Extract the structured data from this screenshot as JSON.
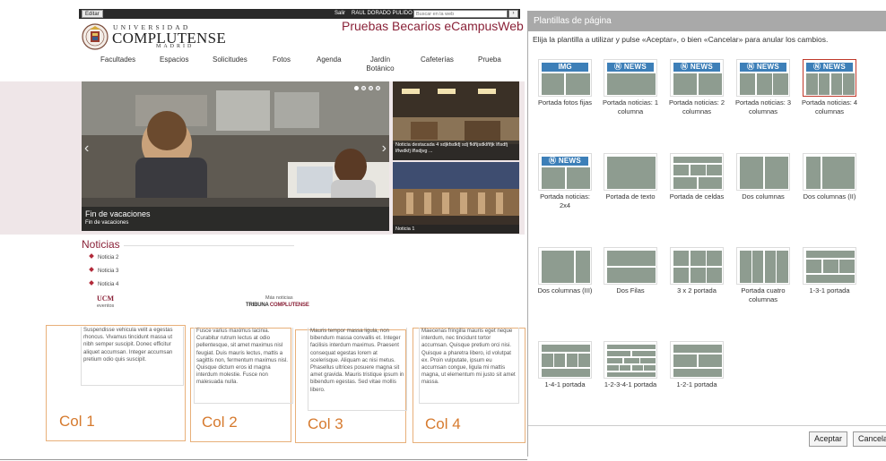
{
  "topbar": {
    "edit_label": "Editar",
    "logout_label": "Salir",
    "user_name": "RAUL DORADO PULIDO",
    "search_placeholder": "Buscar en la web",
    "search_button": "Ir"
  },
  "logo": {
    "line1": "UNIVERSIDAD",
    "line2": "COMPLUTENSE",
    "line3": "MADRID"
  },
  "site_title": "Pruebas Becarios eCampusWeb",
  "nav": [
    "Facultades",
    "Espacios",
    "Solicitudes",
    "Fotos",
    "Agenda",
    "Jardín Botánico",
    "Cafeterías",
    "Prueba"
  ],
  "hero": {
    "title": "Fin de vacaciones",
    "subtitle": "Fin de vacaciones",
    "side1_caption": "Noticia destacada 4 sdjkfsdkfj sdj fklñjsdklñfjk lñsdfj lñwdkfj lñsdjvg ...",
    "side2_caption": "Noticia 1"
  },
  "news": {
    "title": "Noticias",
    "items": [
      "Noticia 2",
      "Noticia 3",
      "Noticia 4"
    ],
    "ucm_label": "UCM",
    "ucm_sub": "eventos",
    "more_label": "Más noticias",
    "tribuna_a": "TRIBUNA",
    "tribuna_b": "COMPLUTENSE"
  },
  "columns": [
    {
      "label": "Col 1",
      "text": "Suspendisse vehicula velit a egestas rhoncus. Vivamus tincidunt massa ut nibh semper suscipit. Donec efficitur aliquet accumsan. Integer accumsan pretium odio quis suscipit."
    },
    {
      "label": "Col 2",
      "text": "Fusce varius maximus lacinia. Curabitur rutrum lectus at odio pellentesque, sit amet maximus nisl feugiat. Duis mauris lectus, mattis a sagittis non, fermentum maximus nisl. Quisque dictum eros id magna interdum molestie. Fusce non malesuada nulla."
    },
    {
      "label": "Col 3",
      "text": "Mauris tempor massa ligula, non bibendum massa convallis et. Integer facilisis interdum maximus. Praesent consequat egestas lorem at scelerisque. Aliquam ac nisi metus. Phasellus ultrices posuere magna sit amet gravida. Mauris tristique ipsum in bibendum egestas. Sed vitae mollis libero."
    },
    {
      "label": "Col 4",
      "text": "Maecenas fringilla mauris eget neque interdum, nec tincidunt tortor accumsan. Quisque pretium orci nisi. Quisque a pharetra libero, id volutpat ex. Proin vulputate, ipsum eu accumsan congue, ligula mi mattis magna, ut elementum mi justo sit amet massa."
    }
  ],
  "dialog": {
    "title": "Plantillas de página",
    "instruction": "Elija la plantilla a utilizar y pulse «Aceptar», o bien «Cancelar» para anular los cambios.",
    "img_text": "IMG",
    "news_text": "NEWS",
    "templates": [
      "Portada fotos fijas",
      "Portada noticias: 1 columna",
      "Portada noticias: 2 columnas",
      "Portada noticias: 3 columnas",
      "Portada noticias: 4 columnas",
      "Portada noticias: 2x4",
      "Portada de texto",
      "Portada de celdas",
      "Dos columnas",
      "Dos columnas (II)",
      "Dos columnas (III)",
      "Dos Filas",
      "3 x 2 portada",
      "Portada cuatro columnas",
      "1-3-1 portada",
      "1-4-1 portada",
      "1-2-3-4-1 portada",
      "1-2-1 portada"
    ],
    "selected_template": "Portada noticias: 4 columnas",
    "accept_label": "Aceptar",
    "cancel_label": "Cancelar"
  },
  "colors": {
    "brand": "#8a2238",
    "accent_orange": "#d67a2e",
    "thumb_block": "#8e9c90",
    "thumb_header": "#3d7fb8",
    "selected_border": "#c0392b"
  }
}
